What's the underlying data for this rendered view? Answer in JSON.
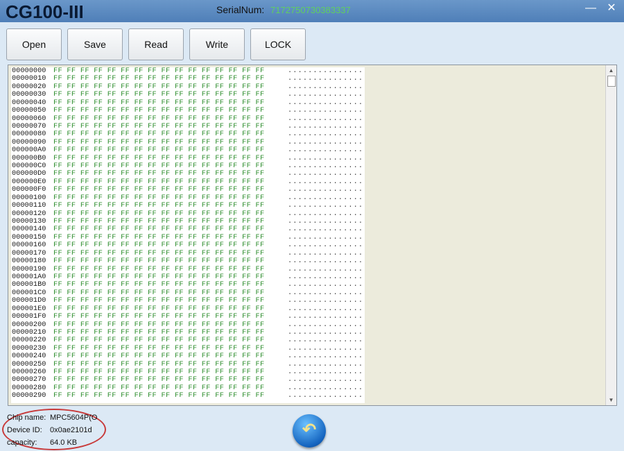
{
  "titlebar": {
    "app_title": "CG100-III",
    "serial_label": "SerialNum:",
    "serial_value": "7172750730383337",
    "minimize_icon": "minimize-icon",
    "close_icon": "close-icon"
  },
  "toolbar": {
    "buttons": [
      "Open",
      "Save",
      "Read",
      "Write",
      "LOCK"
    ]
  },
  "hex": {
    "byte_value": "FF",
    "bytes_per_row": 16,
    "ascii_placeholder": "................",
    "addresses": [
      "00000000",
      "00000010",
      "00000020",
      "00000030",
      "00000040",
      "00000050",
      "00000060",
      "00000070",
      "00000080",
      "00000090",
      "000000A0",
      "000000B0",
      "000000C0",
      "000000D0",
      "000000E0",
      "000000F0",
      "00000100",
      "00000110",
      "00000120",
      "00000130",
      "00000140",
      "00000150",
      "00000160",
      "00000170",
      "00000180",
      "00000190",
      "000001A0",
      "000001B0",
      "000001C0",
      "000001D0",
      "000001E0",
      "000001F0",
      "00000200",
      "00000210",
      "00000220",
      "00000230",
      "00000240",
      "00000250",
      "00000260",
      "00000270",
      "00000280",
      "00000290"
    ]
  },
  "info": {
    "chip_label": "Chip name:",
    "chip_value": "MPC5604P(O",
    "device_label": "Device ID:",
    "device_value": "0x0ae2101d",
    "capacity_label": "capacity:",
    "capacity_value": "64.0 KB"
  },
  "colors": {
    "byte_color": "#2b8c2b",
    "serial_color": "#5fd05f",
    "highlight_ellipse": "#c83a3a"
  },
  "icons": {
    "back": "back-arrow-icon"
  }
}
